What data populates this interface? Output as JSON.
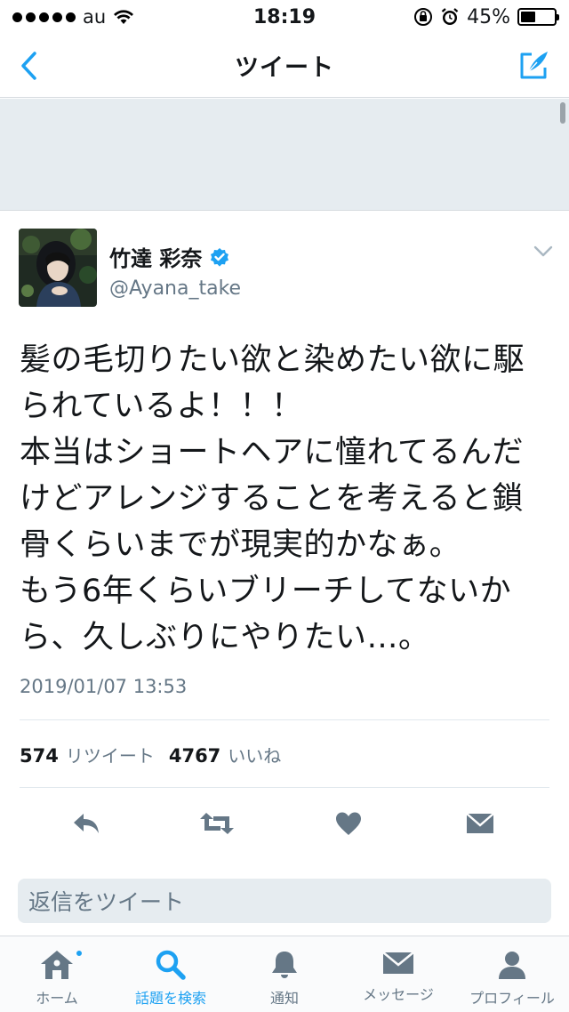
{
  "status_bar": {
    "carrier": "au",
    "time": "18:19",
    "battery": "45%",
    "battery_level": 0.45
  },
  "nav": {
    "title": "ツイート",
    "back_icon": "chevron-left-icon",
    "compose_icon": "compose-icon"
  },
  "tweet": {
    "display_name": "竹達 彩奈",
    "handle": "@Ayana_take",
    "verified": true,
    "text": "髪の毛切りたい欲と染めたい欲に駆\nられているよ！！！\n本当はショートヘアに憧れてるんだ\nけどアレンジすることを考えると鎖\n骨くらいまでが現実的かなぁ。\nもう6年くらいブリーチしてないか\nら、久しぶりにやりたい…。",
    "timestamp": "2019/01/07 13:53",
    "retweets": "574",
    "retweets_label": "リツイート",
    "likes": "4767",
    "likes_label": "いいね"
  },
  "actions": [
    "reply-icon",
    "retweet-icon",
    "like-icon",
    "dm-icon"
  ],
  "reply": {
    "placeholder": "返信をツイート"
  },
  "tabs": [
    {
      "label": "ホーム",
      "icon": "home-icon"
    },
    {
      "label": "話題を検索",
      "icon": "search-icon"
    },
    {
      "label": "通知",
      "icon": "bell-icon"
    },
    {
      "label": "メッセージ",
      "icon": "envelope-icon"
    },
    {
      "label": "プロフィール",
      "icon": "profile-icon"
    }
  ],
  "colors": {
    "accent": "#1da1f2",
    "text_primary": "#14171a",
    "text_secondary": "#657786",
    "icon_gray": "#657786",
    "banner_gray": "#e6ecf0"
  }
}
